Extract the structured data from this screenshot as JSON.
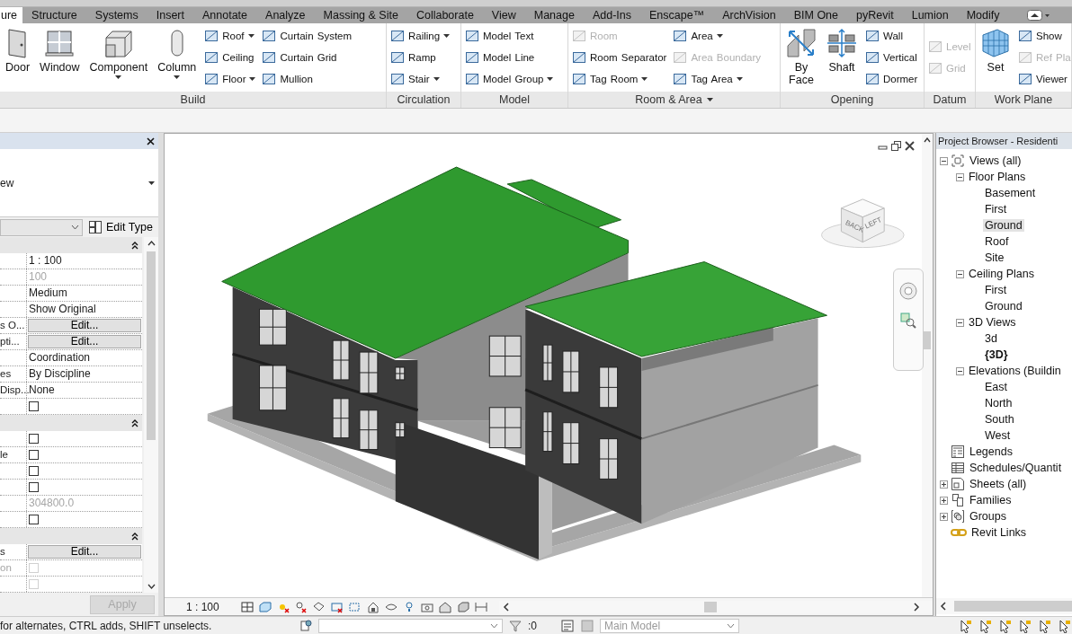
{
  "tabs": [
    {
      "label": "ure",
      "selected": true
    },
    {
      "label": "Structure",
      "selected": false
    },
    {
      "label": "Systems",
      "selected": false
    },
    {
      "label": "Insert",
      "selected": false
    },
    {
      "label": "Annotate",
      "selected": false
    },
    {
      "label": "Analyze",
      "selected": false
    },
    {
      "label": "Massing & Site",
      "selected": false
    },
    {
      "label": "Collaborate",
      "selected": false
    },
    {
      "label": "View",
      "selected": false
    },
    {
      "label": "Manage",
      "selected": false
    },
    {
      "label": "Add-Ins",
      "selected": false
    },
    {
      "label": "Enscape™",
      "selected": false
    },
    {
      "label": "ArchVision",
      "selected": false
    },
    {
      "label": "BIM One",
      "selected": false
    },
    {
      "label": "pyRevit",
      "selected": false
    },
    {
      "label": "Lumion",
      "selected": false
    },
    {
      "label": "Modify",
      "selected": false
    }
  ],
  "panels": [
    {
      "title": "Build",
      "dropdown": false,
      "columns": [
        {
          "kind": "large",
          "label": "Door",
          "dropdown": false
        },
        {
          "kind": "large",
          "label": "Window",
          "dropdown": false
        },
        {
          "kind": "large",
          "label": "Component",
          "dropdown": true
        },
        {
          "kind": "large",
          "label": "Column",
          "dropdown": true
        },
        {
          "kind": "stack",
          "items": [
            {
              "label": "Roof",
              "dropdown": true,
              "disabled": false
            },
            {
              "label": "Ceiling",
              "dropdown": false,
              "disabled": false
            },
            {
              "label": "Floor",
              "dropdown": true,
              "disabled": false
            }
          ]
        },
        {
          "kind": "stack",
          "items": [
            {
              "label": "Curtain System",
              "dropdown": false,
              "disabled": false
            },
            {
              "label": "Curtain Grid",
              "dropdown": false,
              "disabled": false
            },
            {
              "label": "Mullion",
              "dropdown": false,
              "disabled": false
            }
          ]
        }
      ]
    },
    {
      "title": "Circulation",
      "dropdown": false,
      "columns": [
        {
          "kind": "stack",
          "items": [
            {
              "label": "Railing",
              "dropdown": true,
              "disabled": false
            },
            {
              "label": "Ramp",
              "dropdown": false,
              "disabled": false
            },
            {
              "label": "Stair",
              "dropdown": true,
              "disabled": false
            }
          ]
        }
      ]
    },
    {
      "title": "Model",
      "dropdown": false,
      "columns": [
        {
          "kind": "stack",
          "items": [
            {
              "label": "Model Text",
              "dropdown": false,
              "disabled": false
            },
            {
              "label": "Model Line",
              "dropdown": false,
              "disabled": false
            },
            {
              "label": "Model Group",
              "dropdown": true,
              "disabled": false
            }
          ]
        }
      ]
    },
    {
      "title": "Room & Area",
      "dropdown": true,
      "columns": [
        {
          "kind": "stack",
          "items": [
            {
              "label": "Room",
              "dropdown": false,
              "disabled": true
            },
            {
              "label": "Room Separator",
              "dropdown": false,
              "disabled": false
            },
            {
              "label": "Tag Room",
              "dropdown": true,
              "disabled": false
            }
          ]
        },
        {
          "kind": "stack",
          "items": [
            {
              "label": "Area",
              "dropdown": true,
              "disabled": false
            },
            {
              "label": "Area Boundary",
              "dropdown": false,
              "disabled": true
            },
            {
              "label": "Tag Area",
              "dropdown": true,
              "disabled": false
            }
          ]
        }
      ]
    },
    {
      "title": "Opening",
      "dropdown": false,
      "columns": [
        {
          "kind": "large",
          "label": "By Face",
          "dropdown": false
        },
        {
          "kind": "large",
          "label": "Shaft",
          "dropdown": false
        },
        {
          "kind": "stack",
          "items": [
            {
              "label": "Wall",
              "dropdown": false,
              "disabled": false
            },
            {
              "label": "Vertical",
              "dropdown": false,
              "disabled": false
            },
            {
              "label": "Dormer",
              "dropdown": false,
              "disabled": false
            }
          ]
        }
      ]
    },
    {
      "title": "Datum",
      "dropdown": false,
      "columns": [
        {
          "kind": "stack",
          "items": [
            {
              "label": "Level",
              "dropdown": false,
              "disabled": true
            },
            {
              "label": "Grid",
              "dropdown": false,
              "disabled": true
            }
          ]
        }
      ]
    },
    {
      "title": "Work Plane",
      "dropdown": false,
      "columns": [
        {
          "kind": "large",
          "label": "Set",
          "dropdown": false
        },
        {
          "kind": "stack",
          "items": [
            {
              "label": "Show",
              "dropdown": false,
              "disabled": false
            },
            {
              "label": "Ref Pla",
              "dropdown": false,
              "disabled": true
            },
            {
              "label": "Viewer",
              "dropdown": false,
              "disabled": false
            }
          ]
        }
      ]
    }
  ],
  "properties": {
    "type_name": "ew",
    "edit_type": "Edit Type",
    "groups": [
      {
        "expanded": true,
        "rows": [
          {
            "kind": "text",
            "value": "1 : 100",
            "disabled": false
          },
          {
            "kind": "text",
            "value": "100",
            "disabled": true
          },
          {
            "kind": "text",
            "value": "Medium",
            "disabled": false
          },
          {
            "kind": "text",
            "value": "Show Original",
            "disabled": false
          },
          {
            "kind": "button",
            "name": "s O...",
            "value": "Edit..."
          },
          {
            "kind": "button",
            "name": "pti...",
            "value": "Edit..."
          },
          {
            "kind": "text",
            "value": "Coordination",
            "disabled": false
          },
          {
            "kind": "text",
            "name": "es",
            "value": "By Discipline",
            "disabled": false
          },
          {
            "kind": "text",
            "name": "Disp...",
            "value": "None",
            "disabled": false
          },
          {
            "kind": "checkbox",
            "checked": false,
            "disabled": false
          }
        ]
      },
      {
        "expanded": true,
        "rows": [
          {
            "kind": "checkbox",
            "checked": false,
            "disabled": false
          },
          {
            "kind": "checkbox",
            "name": "le",
            "checked": false,
            "disabled": false
          },
          {
            "kind": "checkbox",
            "checked": false,
            "disabled": false
          },
          {
            "kind": "checkbox",
            "checked": false,
            "disabled": false
          },
          {
            "kind": "text",
            "value": "304800.0",
            "disabled": true
          },
          {
            "kind": "checkbox",
            "checked": false,
            "disabled": false
          }
        ]
      },
      {
        "expanded": true,
        "rows": [
          {
            "kind": "button",
            "name": "s",
            "value": "Edit..."
          },
          {
            "kind": "checkbox",
            "name": "on",
            "checked": false,
            "disabled": true
          },
          {
            "kind": "checkbox",
            "checked": false,
            "disabled": true
          }
        ]
      }
    ],
    "apply": {
      "label": "Apply",
      "disabled": true
    }
  },
  "view": {
    "scale": "1 : 100",
    "view_cube": [
      "BACK",
      "LEFT"
    ]
  },
  "project_browser": {
    "title": "Project Browser - Residenti",
    "tree": [
      {
        "label": "Views (all)",
        "selected": false,
        "current": false,
        "expanded": true,
        "children": [
          {
            "label": "Floor Plans",
            "selected": false,
            "current": false,
            "expanded": true,
            "children": [
              {
                "label": "Basement",
                "selected": false,
                "current": false
              },
              {
                "label": "First",
                "selected": false,
                "current": false
              },
              {
                "label": "Ground",
                "selected": true,
                "current": false
              },
              {
                "label": "Roof",
                "selected": false,
                "current": false
              },
              {
                "label": "Site",
                "selected": false,
                "current": false
              }
            ]
          },
          {
            "label": "Ceiling Plans",
            "selected": false,
            "current": false,
            "expanded": true,
            "children": [
              {
                "label": "First",
                "selected": false,
                "current": false
              },
              {
                "label": "Ground",
                "selected": false,
                "current": false
              }
            ]
          },
          {
            "label": "3D Views",
            "selected": false,
            "current": false,
            "expanded": true,
            "children": [
              {
                "label": "3d",
                "selected": false,
                "current": false
              },
              {
                "label": "{3D}",
                "selected": false,
                "current": true
              }
            ]
          },
          {
            "label": "Elevations (Buildin",
            "selected": false,
            "current": false,
            "expanded": true,
            "children": [
              {
                "label": "East",
                "selected": false,
                "current": false
              },
              {
                "label": "North",
                "selected": false,
                "current": false
              },
              {
                "label": "South",
                "selected": false,
                "current": false
              },
              {
                "label": "West",
                "selected": false,
                "current": false
              }
            ]
          }
        ]
      },
      {
        "label": "Legends",
        "selected": false,
        "current": false
      },
      {
        "label": "Schedules/Quantit",
        "selected": false,
        "current": false
      },
      {
        "label": "Sheets (all)",
        "selected": false,
        "current": false,
        "expanded": false
      },
      {
        "label": "Families",
        "selected": false,
        "current": false,
        "expanded": false
      },
      {
        "label": "Groups",
        "selected": false,
        "current": false,
        "expanded": false
      },
      {
        "label": "Revit Links",
        "selected": false,
        "current": false
      }
    ]
  },
  "status_bar": {
    "hint": "for alternates, CTRL adds, SHIFT unselects.",
    "count": ":0",
    "model": "Main Model"
  }
}
